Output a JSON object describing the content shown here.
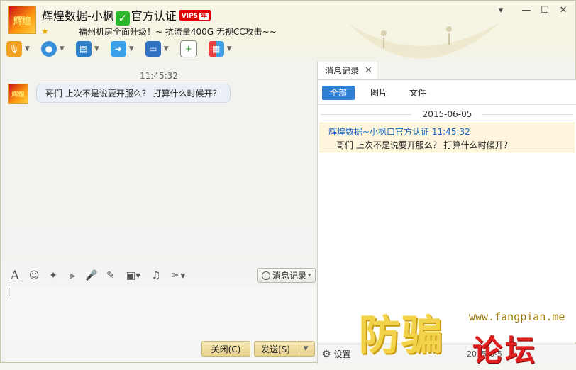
{
  "header": {
    "avatar_text": "辉煌",
    "contact_name": "辉煌数据-小枫",
    "verified_text": "官方认证",
    "vip_label": "VIP5",
    "vip_year": "年",
    "signature": "福州机房全面升级！~ 抗流量400G 无视CC攻击~~"
  },
  "toolbar": {
    "icons": [
      "microphone-icon",
      "camera-icon",
      "screen-share-icon",
      "file-transfer-icon",
      "remote-desktop-icon",
      "message-add-icon",
      "apps-grid-icon"
    ]
  },
  "chat": {
    "timestamp": "11:45:32",
    "avatar_text": "辉煌",
    "message": "哥们  上次不是说要开服么？  打算什么时候开？"
  },
  "input_toolbar": {
    "icons": [
      "font-icon",
      "emoji-icon",
      "magic-icon",
      "shake-icon",
      "voice-icon",
      "edit-icon",
      "image-icon",
      "music-icon",
      "scissors-icon"
    ],
    "history_label": "消息记录"
  },
  "input": {
    "value": "|"
  },
  "actions": {
    "close_label": "关闭(C)",
    "send_label": "发送(S)"
  },
  "history": {
    "tab_label": "消息记录",
    "filters": [
      "全部",
      "图片",
      "文件"
    ],
    "date": "2015-06-05",
    "entry_sender": "辉煌数据~小枫口官方认证 11:45:32",
    "entry_text": "哥们  上次不是说要开服么？  打算什么时候开？",
    "settings_label": "设置",
    "bottom_date": "2015-6-5"
  },
  "watermark": {
    "cn1": "防骗",
    "url": "www.fangpian.me",
    "cn2": "论坛"
  },
  "colors": {
    "accent": "#2f7fd6",
    "sender_blue": "#1a66c2",
    "button_gold": "#e6d08a"
  }
}
